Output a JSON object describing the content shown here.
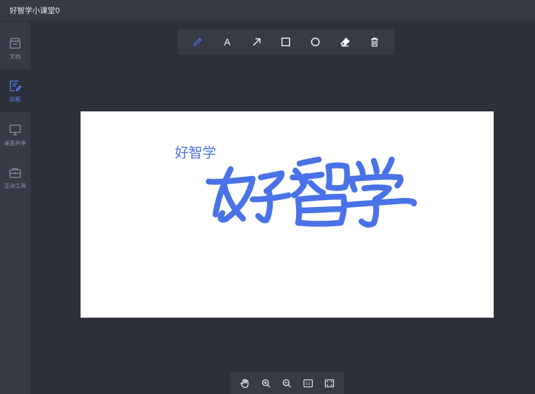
{
  "app": {
    "title": "好智学小课堂0"
  },
  "sidebar": {
    "items": [
      {
        "label": "文档",
        "icon": "archive-icon",
        "active": false
      },
      {
        "label": "白板",
        "icon": "whiteboard-icon",
        "active": true
      },
      {
        "label": "桌面共享",
        "icon": "monitor-icon",
        "active": false
      },
      {
        "label": "互动工具",
        "icon": "toolbox-icon",
        "active": false
      }
    ]
  },
  "toolbar": {
    "tools": [
      {
        "name": "pencil-icon",
        "active": true
      },
      {
        "name": "text-icon",
        "glyph": "A",
        "active": false
      },
      {
        "name": "arrow-icon",
        "active": false
      },
      {
        "name": "rectangle-icon",
        "active": false
      },
      {
        "name": "circle-icon",
        "active": false
      },
      {
        "name": "eraser-icon",
        "active": false
      },
      {
        "name": "trash-icon",
        "active": false
      }
    ]
  },
  "canvas": {
    "typed_text": "好智学",
    "handwritten_text": "好智学",
    "ink_color": "#4a72e8"
  },
  "bottom_toolbar": {
    "tools": [
      {
        "name": "hand-icon"
      },
      {
        "name": "zoom-in-icon"
      },
      {
        "name": "zoom-out-icon"
      },
      {
        "name": "actual-size-icon",
        "label": "1:1"
      },
      {
        "name": "fit-screen-icon"
      }
    ]
  },
  "colors": {
    "background": "#2b303b",
    "panel": "#353a45",
    "accent": "#5b87ff",
    "canvas": "#ffffff"
  }
}
